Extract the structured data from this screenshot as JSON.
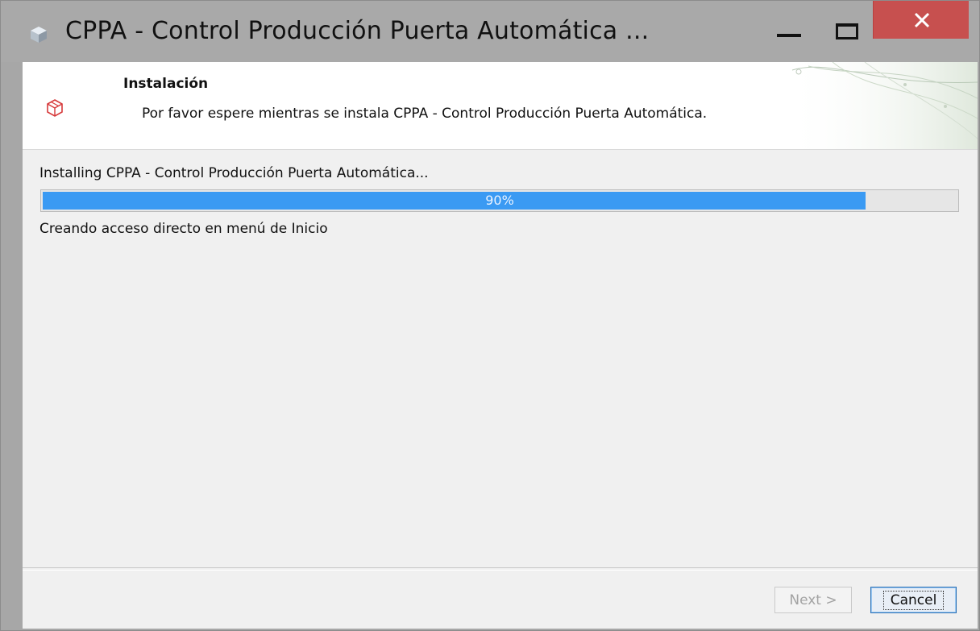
{
  "window": {
    "title": "CPPA - Control Producción Puerta Automática ...",
    "icon": "app-cube-icon",
    "controls": [
      "minimize-icon",
      "maximize-icon",
      "close-icon"
    ],
    "close_color": "#c7504f"
  },
  "header": {
    "title": "Instalación",
    "description": "Por favor espere mientras se instala CPPA - Control Producción Puerta Automática.",
    "icon": "install-box-icon"
  },
  "main": {
    "installing_label": "Installing CPPA - Control Producción Puerta Automática...",
    "progress": {
      "percent": 90,
      "label": "90%",
      "fill_color": "#3a9af3"
    },
    "status": "Creando acceso directo en menú de Inicio"
  },
  "footer": {
    "next_label": "Next >",
    "cancel_label": "Cancel"
  }
}
